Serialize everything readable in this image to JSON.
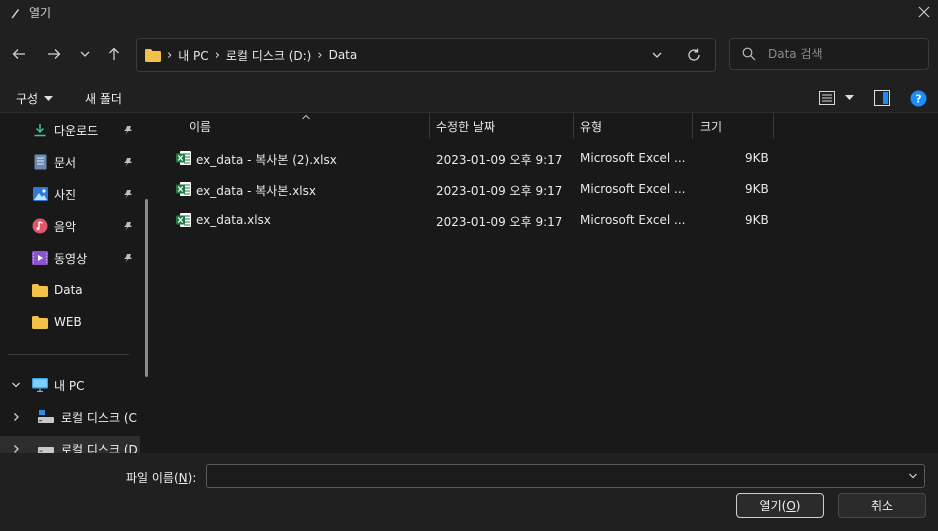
{
  "window": {
    "title": "열기",
    "close_icon": "close-icon",
    "app_icon": "pen-icon"
  },
  "nav": {
    "back_icon": "arrow-left-icon",
    "forward_icon": "arrow-right-icon",
    "recent_icon": "chevron-down-icon",
    "up_icon": "arrow-up-icon",
    "breadcrumb": [
      "내 PC",
      "로컬 디스크 (D:)",
      "Data"
    ],
    "search_placeholder": "Data 검색"
  },
  "commandbar": {
    "organize_label": "구성",
    "new_folder_label": "새 폴더"
  },
  "sidebar": {
    "quick_access": [
      {
        "label": "다운로드",
        "icon": "download-icon",
        "pinned": true
      },
      {
        "label": "문서",
        "icon": "document-icon",
        "pinned": true
      },
      {
        "label": "사진",
        "icon": "pictures-icon",
        "pinned": true
      },
      {
        "label": "음악",
        "icon": "music-icon",
        "pinned": true
      },
      {
        "label": "동영상",
        "icon": "video-icon",
        "pinned": true
      },
      {
        "label": "Data",
        "icon": "folder-icon",
        "pinned": false
      },
      {
        "label": "WEB",
        "icon": "folder-icon",
        "pinned": false
      }
    ],
    "this_pc": {
      "label": "내 PC",
      "icon": "computer-icon"
    },
    "drives": [
      {
        "label": "로컬 디스크 (C",
        "icon": "drive-icon"
      },
      {
        "label": "로컬 디스크 (D",
        "icon": "drive-icon"
      }
    ]
  },
  "columns": {
    "name": "이름",
    "modified": "수정한 날짜",
    "type": "유형",
    "size": "크기"
  },
  "files": [
    {
      "name": "ex_data - 복사본 (2).xlsx",
      "modified": "2023-01-09 오후 9:17",
      "type": "Microsoft Excel ...",
      "size": "9KB"
    },
    {
      "name": "ex_data - 복사본.xlsx",
      "modified": "2023-01-09 오후 9:17",
      "type": "Microsoft Excel ...",
      "size": "9KB"
    },
    {
      "name": "ex_data.xlsx",
      "modified": "2023-01-09 오후 9:17",
      "type": "Microsoft Excel ...",
      "size": "9KB"
    }
  ],
  "footer": {
    "filename_label": "파일 이름(",
    "filename_label_key": "N",
    "filename_label_end": "):",
    "filename_value": "",
    "open_label": "열기(",
    "open_key": "O",
    "open_end": ")",
    "cancel_label": "취소"
  },
  "colors": {
    "bg": "#191919",
    "chrome": "#202020",
    "accent_blue": "#0a84ff",
    "excel_green": "#1d7a43",
    "folder_yellow": "#f2c14a"
  }
}
